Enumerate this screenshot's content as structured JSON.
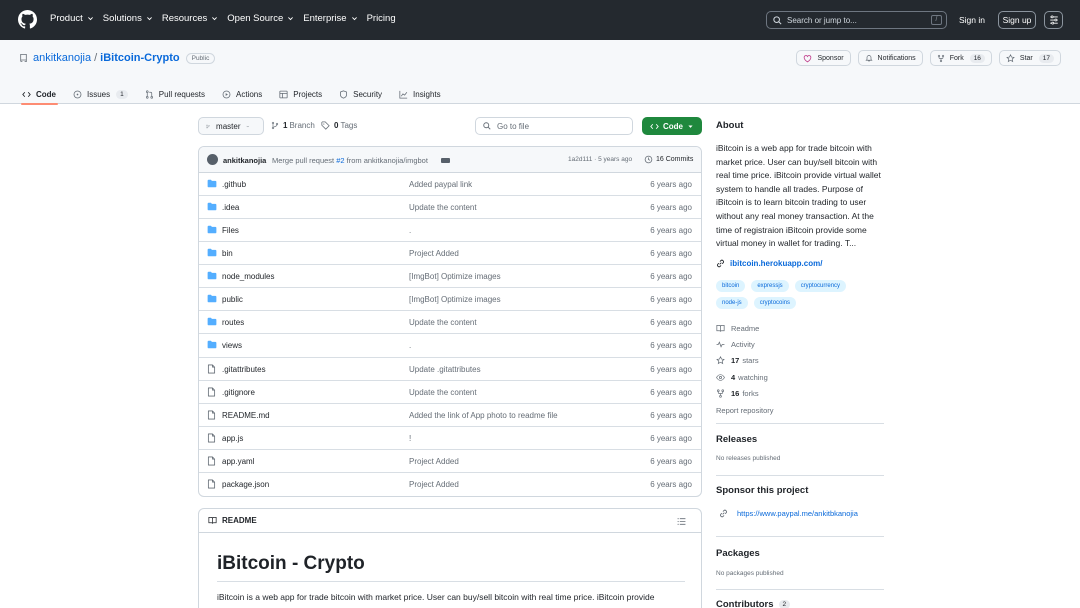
{
  "header": {
    "nav": [
      {
        "label": "Product",
        "dropdown": true
      },
      {
        "label": "Solutions",
        "dropdown": true
      },
      {
        "label": "Resources",
        "dropdown": true
      },
      {
        "label": "Open Source",
        "dropdown": true
      },
      {
        "label": "Enterprise",
        "dropdown": true
      },
      {
        "label": "Pricing",
        "dropdown": false
      }
    ],
    "search_placeholder": "Search or jump to...",
    "search_shortcut": "/",
    "sign_in": "Sign in",
    "sign_up": "Sign up"
  },
  "repo": {
    "owner": "ankitkanojia",
    "separator": "/",
    "name": "iBitcoin-Crypto",
    "visibility": "Public",
    "actions": {
      "sponsor": "Sponsor",
      "notifications": "Notifications",
      "fork": "Fork",
      "fork_count": "16",
      "star": "Star",
      "star_count": "17"
    },
    "tabs": [
      {
        "label": "Code",
        "icon": "code-icon",
        "active": true
      },
      {
        "label": "Issues",
        "icon": "issue-icon",
        "count": "1"
      },
      {
        "label": "Pull requests",
        "icon": "pull-request-icon"
      },
      {
        "label": "Actions",
        "icon": "play-icon"
      },
      {
        "label": "Projects",
        "icon": "table-icon"
      },
      {
        "label": "Security",
        "icon": "shield-icon"
      },
      {
        "label": "Insights",
        "icon": "graph-icon"
      }
    ]
  },
  "toolbar": {
    "branch": "master",
    "branch_count": "1",
    "branch_label": "Branch",
    "tag_count": "0",
    "tag_label": "Tags",
    "goto_placeholder": "Go to file",
    "code_button": "Code"
  },
  "latest_commit": {
    "author": "ankitkanojia",
    "message_prefix": "Merge pull request ",
    "pr": "#2",
    "message_suffix": " from ankitkanojia/imgbot",
    "sha_time": "1a2d111 · 5 years ago",
    "commits": "16 Commits"
  },
  "files": [
    {
      "name": ".github",
      "type": "dir",
      "message": "Added paypal link",
      "age": "6 years ago"
    },
    {
      "name": ".idea",
      "type": "dir",
      "message": "Update the content",
      "age": "6 years ago"
    },
    {
      "name": "Files",
      "type": "dir",
      "message": ".",
      "age": "6 years ago"
    },
    {
      "name": "bin",
      "type": "dir",
      "message": "Project Added",
      "age": "6 years ago"
    },
    {
      "name": "node_modules",
      "type": "dir",
      "message": "[ImgBot] Optimize images",
      "age": "6 years ago"
    },
    {
      "name": "public",
      "type": "dir",
      "message": "[ImgBot] Optimize images",
      "age": "6 years ago"
    },
    {
      "name": "routes",
      "type": "dir",
      "message": "Update the content",
      "age": "6 years ago"
    },
    {
      "name": "views",
      "type": "dir",
      "message": ".",
      "age": "6 years ago"
    },
    {
      "name": ".gitattributes",
      "type": "file",
      "message": "Update .gitattributes",
      "age": "6 years ago"
    },
    {
      "name": ".gitignore",
      "type": "file",
      "message": "Update the content",
      "age": "6 years ago"
    },
    {
      "name": "README.md",
      "type": "file",
      "message": "Added the link of App photo to readme file",
      "age": "6 years ago"
    },
    {
      "name": "app.js",
      "type": "file",
      "message": "!",
      "age": "6 years ago"
    },
    {
      "name": "app.yaml",
      "type": "file",
      "message": "Project Added",
      "age": "6 years ago"
    },
    {
      "name": "package.json",
      "type": "file",
      "message": "Project Added",
      "age": "6 years ago"
    }
  ],
  "readme": {
    "header": "README",
    "title": "iBitcoin - Crypto",
    "text": "iBitcoin is a web app for trade bitcoin with market price. User can buy/sell bitcoin with real time price. iBitcoin provide"
  },
  "sidebar": {
    "about_title": "About",
    "about_text": "iBitcoin is a web app for trade bitcoin with market price. User can buy/sell bitcoin with real time price. iBitcoin provide virtual wallet system to handle all trades. Purpose of iBitcoin is to learn bitcoin trading to user without any real money transaction. At the time of registraion iBitcoin provide some virtual money in wallet for trading. T...",
    "website": "ibitcoin.herokuapp.com/",
    "topics": [
      "bitcoin",
      "expressjs",
      "cryptocurrency",
      "node-js",
      "cryptocoins"
    ],
    "readme": "Readme",
    "activity": "Activity",
    "stars_count": "17",
    "stars_label": "stars",
    "watching_count": "4",
    "watching_label": "watching",
    "forks_count": "16",
    "forks_label": "forks",
    "report": "Report repository",
    "releases_title": "Releases",
    "releases_empty": "No releases published",
    "sponsor_title": "Sponsor this project",
    "sponsor_link": "https://www.paypal.me/ankitbkanojia",
    "packages_title": "Packages",
    "packages_empty": "No packages published",
    "contributors_title": "Contributors",
    "contributors_count": "2"
  },
  "colors": {
    "header_bg": "#24292f",
    "accent_link": "#0969da",
    "code_button": "#1f883d",
    "tab_underline": "#fd8c73",
    "folder_icon": "#54aeff",
    "topic_bg": "#ddf4ff"
  }
}
